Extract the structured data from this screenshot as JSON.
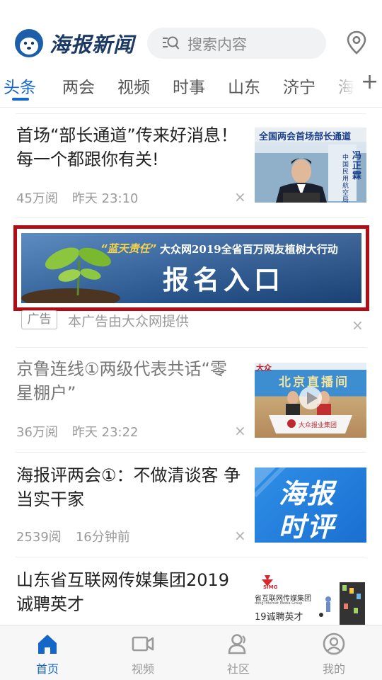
{
  "header": {
    "app_name": "海报新闻",
    "search_placeholder": "搜索内容",
    "logo_icon": "seal-mascot-icon",
    "location_icon": "location-pin-icon"
  },
  "tabs": [
    {
      "label": "头条",
      "active": true
    },
    {
      "label": "两会"
    },
    {
      "label": "视频"
    },
    {
      "label": "时事"
    },
    {
      "label": "山东"
    },
    {
      "label": "济宁"
    },
    {
      "label": "海"
    }
  ],
  "tab_add_label": "+",
  "news": [
    {
      "title": "首场“部长通道”传来好消息！每一个都跟你有关!",
      "views": "45万阅",
      "time": "昨天 23:10",
      "thumb": {
        "banner": "全国两会首场部长通道",
        "name": "冯正霖",
        "role": "中国民用航空局局长"
      }
    },
    {
      "title": "京鲁连线①两级代表共话“零星棚户”",
      "views": "36万阅",
      "time": "昨天 23:22",
      "read": true,
      "thumb": {
        "banner": "北京直播间",
        "logo": "大众",
        "desk": "大众报业集团"
      }
    },
    {
      "title": "海报评两会①：不做清谈客 争当实干家",
      "views": "2539阅",
      "time": "16分钟前",
      "thumb": {
        "line1": "海报",
        "line2": "时评"
      }
    },
    {
      "title": "山东省互联网传媒集团2019诚聘英才",
      "thumb": {
        "brand": "SIMG",
        "group": "省互联网传媒集团",
        "group_en": "dong Internet Media Group",
        "slogan": "19诚聘英才"
      }
    }
  ],
  "ad": {
    "quote": "“蓝天责任”",
    "headline": "大众网2019全省百万网友植树大行动",
    "cta": "报名入口",
    "badge": "广告",
    "source": "本广告由大众网提供"
  },
  "dismiss_symbol": "×",
  "bottom_nav": [
    {
      "label": "首页",
      "icon": "home-icon",
      "active": true
    },
    {
      "label": "视频",
      "icon": "video-camera-icon"
    },
    {
      "label": "社区",
      "icon": "community-user-icon"
    },
    {
      "label": "我的",
      "icon": "profile-icon"
    }
  ],
  "colors": {
    "accent": "#1466c8",
    "ad_border": "#b00d17",
    "logo_text": "#1c3a63"
  }
}
